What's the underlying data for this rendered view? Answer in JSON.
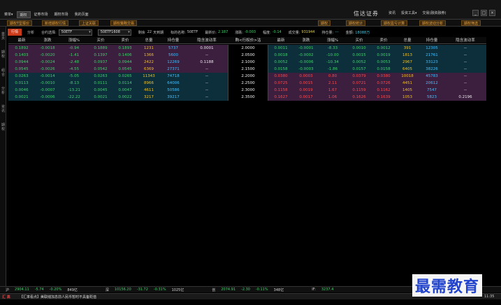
{
  "window": {
    "menu": [
      "菜单▾",
      "期权",
      "证券市场",
      "期权市场",
      "我的页面"
    ],
    "active_menu_index": 1,
    "brand": "信达证券",
    "brand_menu": [
      "资讯",
      "投资工具▾",
      "交易(融资融券)"
    ],
    "window_buttons": [
      "_",
      "□",
      "×"
    ]
  },
  "quick_bar": {
    "buttons": [
      "期权T型报价",
      "新增期权行情",
      "上证关联",
      "期权策略交易"
    ],
    "right_buttons": [
      "期权统计",
      "期权盈亏计算",
      "期权波动分析",
      "期权筛选"
    ],
    "right_extra": "期权"
  },
  "sidebar": {
    "items": [
      "首页",
      "期权",
      "组合",
      "分析",
      "资讯",
      "期权"
    ]
  },
  "control": {
    "tab_active": "行情",
    "tab_other": "分析",
    "contract_label": "合约选择:",
    "contract_value": "50ETF",
    "month_value": "50ETF1608",
    "remaining_label": "剩余",
    "remaining_value": "22",
    "remaining_unit": "天到期",
    "underlying_label": "标的名称:",
    "underlying_value": "50ETF",
    "last_label": "最新价:",
    "last_value": "2.187",
    "change_label": "涨跌:",
    "change_value": "-0.003",
    "pct_label": "幅度:",
    "pct_value": "-0.14",
    "volume_label": "成交量:",
    "volume_value": "931944",
    "position_label": "持仓量:",
    "position_value": "---",
    "amount_label": "金额:",
    "amount_value": "18088万"
  },
  "left_headers": [
    "最新",
    "涨跌",
    "涨幅%",
    "买价",
    "卖价",
    "总量",
    "持仓量",
    "隐含波动率"
  ],
  "center_header": "购<行权价>沽",
  "right_headers": [
    "最新",
    "涨跌",
    "涨幅%",
    "买价",
    "卖价",
    "总量",
    "持仓量",
    "隐含波动率"
  ],
  "rows": [
    {
      "strike": "2.0000",
      "call": [
        "0.1892",
        "-0.0018",
        "-0.94",
        "0.1889",
        "0.1893",
        "1231",
        "5737",
        "0.0001"
      ],
      "put": [
        "0.0011",
        "-0.0001",
        "-8.33",
        "0.0010",
        "0.0012",
        "391",
        "12305",
        "--"
      ]
    },
    {
      "strike": "2.0500",
      "call": [
        "0.1403",
        "-0.0020",
        "-1.41",
        "0.1397",
        "0.1406",
        "1366",
        "5600",
        "--"
      ],
      "put": [
        "0.0018",
        "-0.0002",
        "-10.00",
        "0.0015",
        "0.0019",
        "1813",
        "21761",
        "--"
      ]
    },
    {
      "strike": "2.1000",
      "call": [
        "0.0944",
        "-0.0024",
        "-2.48",
        "0.0937",
        "0.0944",
        "2422",
        "12269",
        "0.1188"
      ],
      "put": [
        "0.0052",
        "-0.0006",
        "-10.34",
        "0.0052",
        "0.0053",
        "2967",
        "33123",
        "--"
      ]
    },
    {
      "strike": "2.1500",
      "call": [
        "0.0545",
        "-0.0026",
        "-4.55",
        "0.0542",
        "0.0545",
        "6369",
        "27371",
        "--"
      ],
      "put": [
        "0.0158",
        "-0.0003",
        "-1.86",
        "0.0157",
        "0.0158",
        "6405",
        "38226",
        "--"
      ]
    },
    {
      "strike": "2.2000",
      "call": [
        "0.0263",
        "-0.0014",
        "-5.05",
        "0.0263",
        "0.0265",
        "11343",
        "74718",
        "--"
      ],
      "put": [
        "0.0380",
        "0.0003",
        "0.80",
        "0.0379",
        "0.0380",
        "10018",
        "45783",
        "--"
      ]
    },
    {
      "strike": "2.2500",
      "call": [
        "0.0113",
        "-0.0010",
        "-8.13",
        "0.0111",
        "0.0114",
        "8966",
        "64006",
        "--"
      ],
      "put": [
        "0.0725",
        "0.0015",
        "2.11",
        "0.0721",
        "0.0726",
        "4451",
        "20612",
        "--"
      ]
    },
    {
      "strike": "2.3000",
      "call": [
        "0.0046",
        "-0.0007",
        "-13.21",
        "0.0045",
        "0.0047",
        "4611",
        "50586",
        "--"
      ],
      "put": [
        "0.1158",
        "0.0019",
        "1.67",
        "0.1159",
        "0.1162",
        "1405",
        "7547",
        "--"
      ]
    },
    {
      "strike": "2.3500",
      "call": [
        "0.0021",
        "-0.0006",
        "-22.22",
        "0.0021",
        "0.0022",
        "3217",
        "39217",
        "--"
      ],
      "put": [
        "0.1627",
        "0.0017",
        "1.06",
        "0.1626",
        "0.1639",
        "1053",
        "5823",
        "0.2196"
      ]
    }
  ],
  "status": [
    "沪",
    "2904.11",
    "-5.74",
    "-0.20%",
    "849亿",
    "深",
    "10156.20",
    "-31.72",
    "-0.31%",
    "1025亿",
    "创",
    "2074.91",
    "-2.30",
    "-0.11%",
    "348亿",
    "IF:",
    "3237.4"
  ],
  "bottom": {
    "left_logo": "汇 高",
    "ticker": "【汇率看点】美联储加息前人民币暂时不具备贬值",
    "right_time": "11:35"
  },
  "watermark": "最需教育",
  "colors": {
    "call_itm_bg": "#3c1e3e",
    "call_otm_bg": "#0d2f3c",
    "put_otm_bg": "#0d2f3c",
    "put_itm_bg": "#3c1e3e",
    "down": "#3fd06a",
    "up": "#ff4a4a",
    "volume": "#f0c020",
    "position": "#40c0ff"
  }
}
